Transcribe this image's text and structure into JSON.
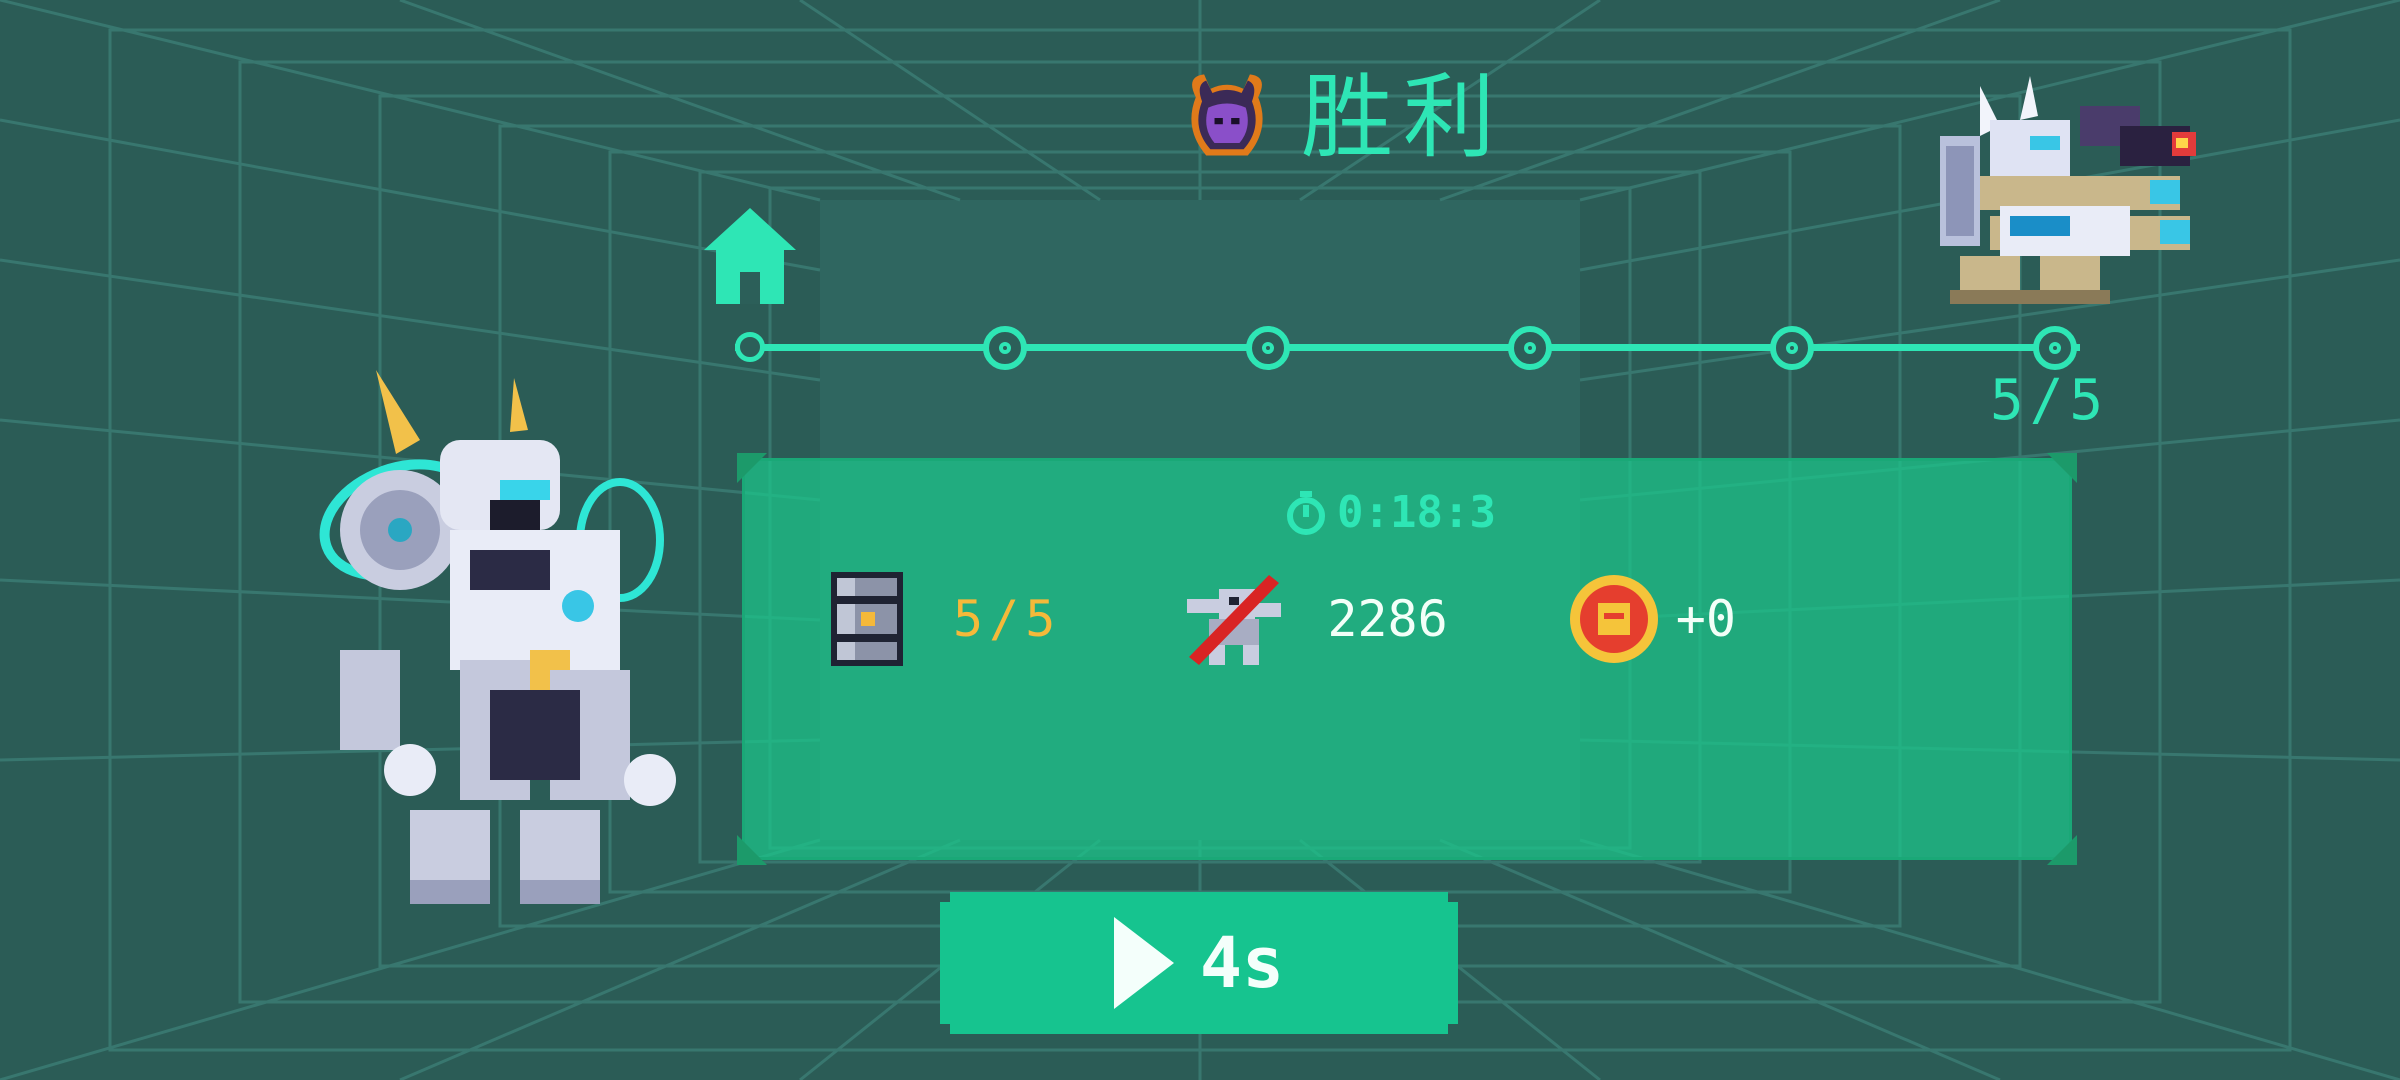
{
  "header": {
    "title": "胜利"
  },
  "progress": {
    "stages_total": 5,
    "stages_cleared": 5,
    "count_label": "5/5"
  },
  "results": {
    "time": "0:18:3",
    "barrels_label": "5/5",
    "kill_score": "2286",
    "coins_label": "+0"
  },
  "continue_button": {
    "label": "4s"
  },
  "colors": {
    "accent": "#2ee6b5",
    "panel": "#1cc88a",
    "background": "#2c5f59",
    "gold": "#f5b93a"
  },
  "icons": [
    "demon-emblem-icon",
    "home-icon",
    "stopwatch-icon",
    "barrel-icon",
    "robot-kill-icon",
    "coin-icon",
    "play-icon"
  ]
}
